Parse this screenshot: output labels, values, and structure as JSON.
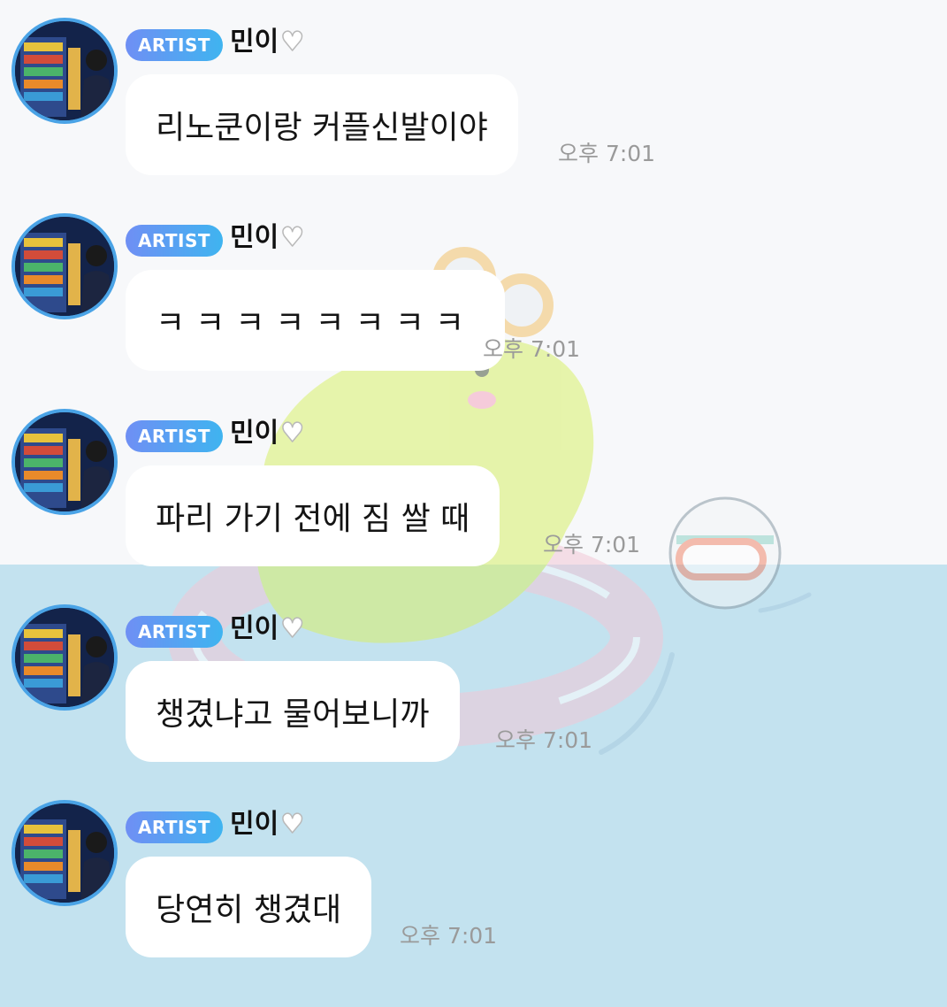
{
  "chat": {
    "messages": [
      {
        "badge": "ARTIST",
        "sender": "민이",
        "heart": "🤍",
        "text": "리노쿤이랑 커플신발이야",
        "time": "오후 7:01"
      },
      {
        "badge": "ARTIST",
        "sender": "민이",
        "heart": "🤍",
        "text": "ㅋㅋㅋㅋㅋㅋㅋㅋ",
        "time": "오후 7:01"
      },
      {
        "badge": "ARTIST",
        "sender": "민이",
        "heart": "🤍",
        "text": "파리 가기 전에 짐 쌀 때",
        "time": "오후 7:01"
      },
      {
        "badge": "ARTIST",
        "sender": "민이",
        "heart": "🤍",
        "text": "챙겼냐고 물어보니까",
        "time": "오후 7:01"
      },
      {
        "badge": "ARTIST",
        "sender": "민이",
        "heart": "🤍",
        "text": "당연히 챙겼대",
        "time": "오후 7:01"
      }
    ]
  },
  "colors": {
    "background_top": "#f7f8fa",
    "background_water": "#c3e2ef",
    "badge_gradient_start": "#6f8ff4",
    "badge_gradient_end": "#3fb4f0",
    "avatar_ring": "#4aa3e6",
    "bubble": "#ffffff",
    "timestamp": "#9a9a9a"
  },
  "icons": {
    "background": "frog-on-swim-ring-illustration",
    "swimmer": "swimmer-with-goggles-illustration",
    "heart": "white-heart-icon"
  }
}
